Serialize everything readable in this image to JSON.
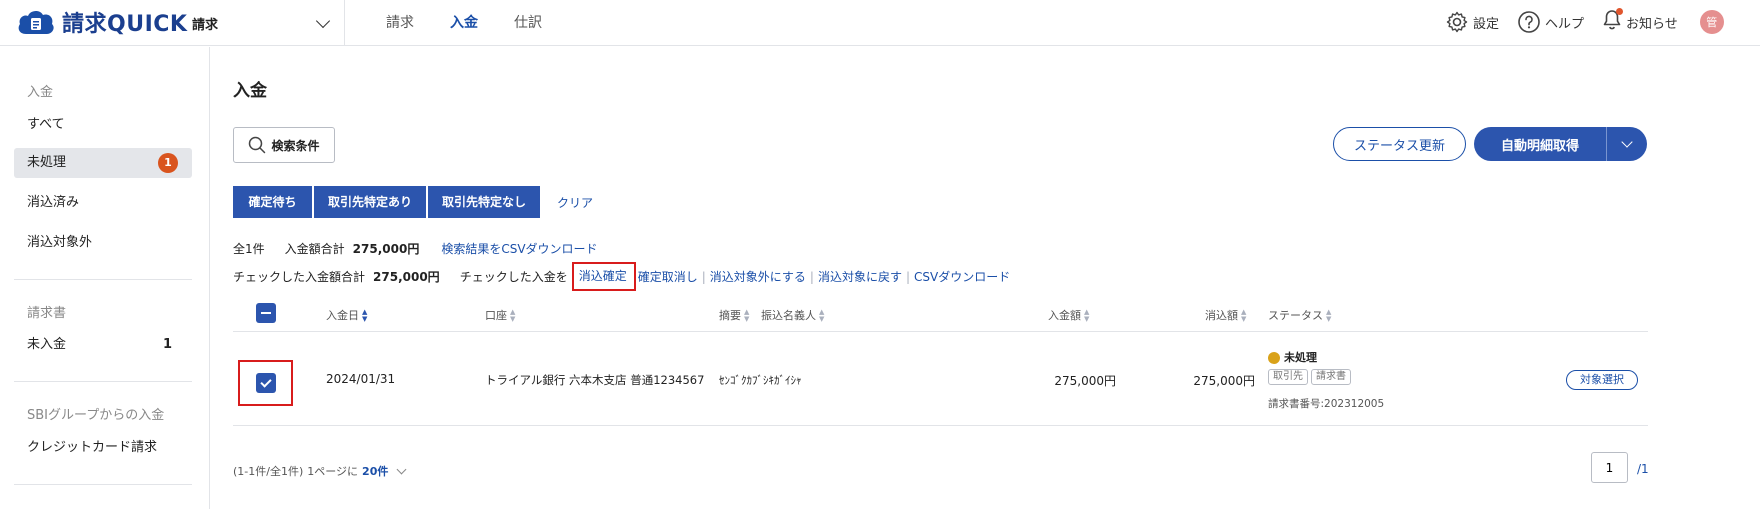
{
  "header": {
    "logo_text": "請求QUICK",
    "product": "請求",
    "nav": [
      {
        "label": "請求"
      },
      {
        "label": "入金"
      },
      {
        "label": "仕訳"
      }
    ],
    "settings_label": "設定",
    "help_label": "ヘルプ",
    "notifications_label": "お知らせ",
    "avatar_label": "管"
  },
  "sidebar": {
    "section1": "入金",
    "items1": [
      {
        "label": "すべて"
      },
      {
        "label": "未処理",
        "badge": "1"
      },
      {
        "label": "消込済み"
      },
      {
        "label": "消込対象外"
      }
    ],
    "section2": "請求書",
    "items2": [
      {
        "label": "未入金",
        "count": "1"
      }
    ],
    "section3": "SBIグループからの入金",
    "items3": [
      {
        "label": "クレジットカード請求"
      }
    ]
  },
  "main": {
    "title": "入金",
    "search_label": "検索条件",
    "status_update_label": "ステータス更新",
    "auto_fetch_label": "自動明細取得",
    "tabs": [
      {
        "label": "確定待ち"
      },
      {
        "label": "取引先特定あり"
      },
      {
        "label": "取引先特定なし"
      }
    ],
    "clear_label": "クリア",
    "summary": {
      "count": "全1件",
      "total_label": "入金額合計",
      "total_value": "275,000円",
      "csv_search_label": "検索結果をCSVダウンロード",
      "checked_total_label": "チェックした入金額合計",
      "checked_total_value": "275,000円",
      "checked_action_label": "チェックした入金を",
      "actions": [
        "消込確定",
        "確定取消し",
        "消込対象外にする",
        "消込対象に戻す",
        "CSVダウンロード"
      ]
    },
    "table": {
      "headers": {
        "date": "入金日",
        "account": "口座",
        "memo": "摘要",
        "payer": "振込名義人",
        "amount": "入金額",
        "cleared": "消込額",
        "status": "ステータス"
      },
      "rows": [
        {
          "date": "2024/01/31",
          "account": "トライアル銀行 六本木支店 普通1234567",
          "payer": "ｾﾝｺﾞｸｶﾌﾞｼｷｶﾞｲｼｬ",
          "amount": "275,000円",
          "cleared": "275,000円",
          "status": "未処理",
          "tag1": "取引先",
          "tag2": "請求書",
          "invoice_no": "請求書番号:202312005",
          "action": "対象選択"
        }
      ]
    },
    "pagination": {
      "range": "(1-1件/全1件)",
      "per_page_label": "1ページに",
      "per_page": "20件",
      "current": "1",
      "total": "/1"
    }
  },
  "colors": {
    "primary": "#2c55ae",
    "link": "#1b4fa8",
    "highlight": "#d81c1c",
    "badge": "#d9541e",
    "status_pending": "#d9a21a"
  }
}
